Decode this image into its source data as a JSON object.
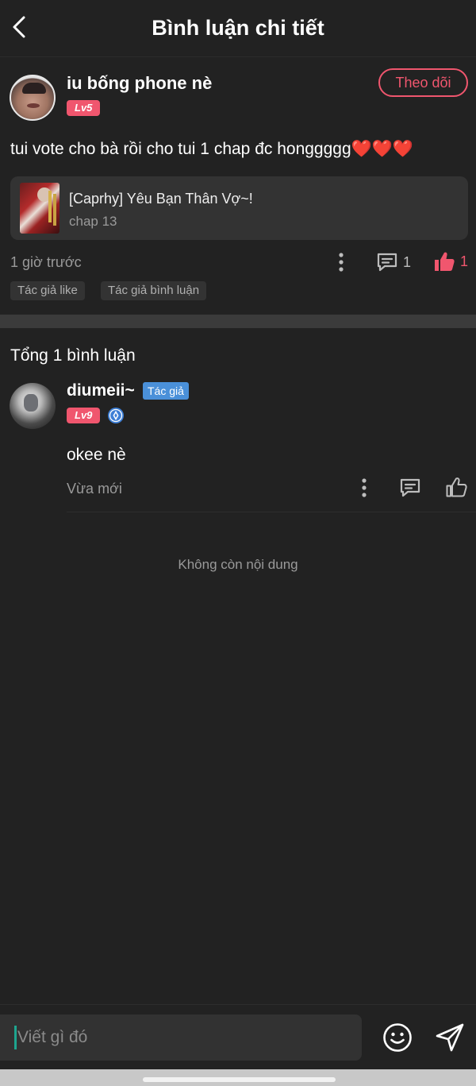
{
  "header": {
    "title": "Bình luận chi tiết"
  },
  "post": {
    "username": "iu bống phone nè",
    "level": "Lv5",
    "follow_label": "Theo dõi",
    "text": "tui vote cho bà rồi cho tui 1 chap đc honggggg❤️❤️❤️",
    "comic": {
      "title": "[Caprhy] Yêu Bạn Thân Vợ~!",
      "chapter": "chap 13"
    },
    "time": "1 giờ trước",
    "reply_count": "1",
    "like_count": "1",
    "tags": [
      "Tác giả like",
      "Tác giả bình luận"
    ]
  },
  "comments_section": {
    "title": "Tổng 1 bình luận",
    "comments": [
      {
        "username": "diumeii~",
        "author_badge": "Tác giả",
        "level": "Lv9",
        "text": "okee nè",
        "time": "Vừa mới"
      }
    ],
    "end_text": "Không còn nội dung"
  },
  "composer": {
    "placeholder": "Viết gì đó"
  },
  "colors": {
    "background": "#222222",
    "accent": "#f0566e",
    "author_badge": "#4a90d9",
    "muted_text": "#9a9a9a",
    "card": "#333333"
  },
  "icons": {
    "back": "chevron-left-icon",
    "more": "more-vertical-icon",
    "reply": "comment-icon",
    "like": "thumbs-up-icon",
    "verified": "verified-badge-icon",
    "emoji": "emoji-icon",
    "send": "send-icon"
  }
}
